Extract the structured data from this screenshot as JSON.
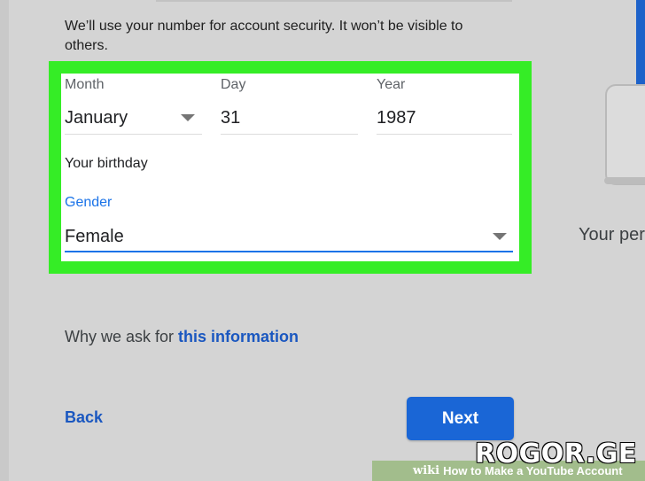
{
  "note": "We’ll use your number for account security. It won’t be visible to others.",
  "birthday": {
    "month_label": "Month",
    "month_value": "January",
    "day_label": "Day",
    "day_value": "31",
    "year_label": "Year",
    "year_value": "1987",
    "caption": "Your birthday"
  },
  "gender": {
    "label": "Gender",
    "value": "Female"
  },
  "why": {
    "prefix": "Why we ask for ",
    "link": "this information"
  },
  "buttons": {
    "back": "Back",
    "next": "Next"
  },
  "side": {
    "text": "Your per"
  },
  "watermark": {
    "site": "ROGOR.GE",
    "wiki": "wiki",
    "title": "How to Make a YouTube Account"
  },
  "colors": {
    "highlight": "#35ed26",
    "primary": "#1a66d6",
    "link": "#1a57c0",
    "focus": "#1a73e8"
  }
}
